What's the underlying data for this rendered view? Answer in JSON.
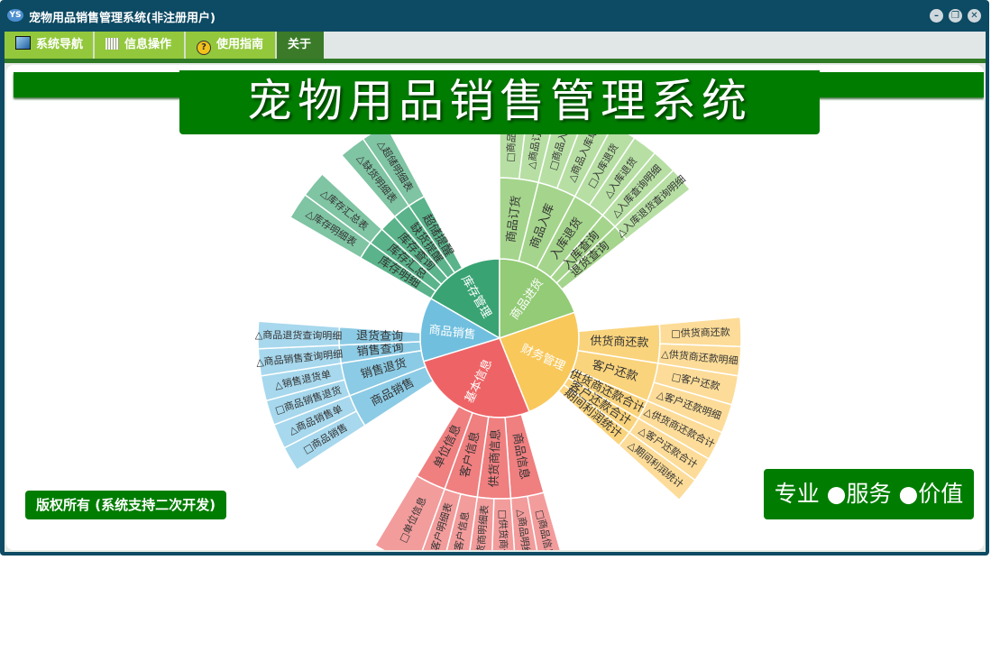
{
  "window": {
    "title": "宠物用品销售管理系统(非注册用户)"
  },
  "menu": [
    {
      "label": "系统导航",
      "icon": "monitor-icon"
    },
    {
      "label": "信息操作",
      "icon": "grid-icon"
    },
    {
      "label": "使用指南",
      "icon": "help-icon"
    },
    {
      "label": "关于"
    }
  ],
  "header": {
    "title": "宠物用品销售管理系统"
  },
  "footer": {
    "copyright": "版权所有 (系统支持二次开发)",
    "slogan": "专业 ●服务 ●价值"
  },
  "sunburst": {
    "ring1": [
      "库存管理",
      "商品进货",
      "财务管理",
      "基本信息",
      "商品销售"
    ],
    "ring2": {
      "库存管理": [
        "库存明细",
        "库存汇总",
        "库存查询",
        "缺货提醒",
        "超储提醒"
      ],
      "商品进货": [
        "商品订货",
        "商品入库",
        "入库退货",
        "入库查询",
        "退货查询"
      ],
      "财务管理": [
        "供货商还款",
        "客户还款",
        "供货商还款合计",
        "客户还款合计",
        "期间利润统计"
      ],
      "基本信息": [
        "商品信息",
        "供货商信息",
        "客户信息",
        "单位信息"
      ],
      "商品销售": [
        "商品销售",
        "销售退货",
        "销售查询",
        "退货查询"
      ]
    },
    "ring3": {
      "库存管理": [
        "△库存明细表",
        "△库存汇总表",
        "",
        "△缺货明细表",
        "△超储明细表"
      ],
      "商品进货": [
        "□商品订货",
        "△商品订货单",
        "□商品入库",
        "△商品入库单",
        "□入库退货",
        "△入库退货",
        "△入库查询明细",
        "△入库退货查询明细"
      ],
      "财务管理": [
        "□供货商还款",
        "△供货商还款明细",
        "□客户还款",
        "△客户还款明细",
        "△供货商还款合计",
        "△客户还款合计",
        "△期间利润统计"
      ],
      "基本信息": [
        "□商品信息",
        "△商品明细表",
        "□供货商信息",
        "△供货商明细表",
        "□客户信息",
        "△客户明细表",
        "□单位信息"
      ],
      "商品销售": [
        "□商品销售",
        "△商品销售单",
        "□商品销售退货",
        "△销售退货单",
        "△商品销售查询明细",
        "△商品退货查询明细"
      ]
    },
    "colors": {
      "库存管理": [
        "#3aa374",
        "#5ab38a",
        "#7fc4a3"
      ],
      "商品进货": [
        "#93cb76",
        "#a5d58c",
        "#b7dfa4"
      ],
      "财务管理": [
        "#f9c85a",
        "#fad47c",
        "#fcdc98"
      ],
      "基本信息": [
        "#ee6466",
        "#f07f80",
        "#f39c9c"
      ],
      "商品销售": [
        "#70bfdf",
        "#8ccbe5",
        "#a7d8ed"
      ]
    }
  }
}
